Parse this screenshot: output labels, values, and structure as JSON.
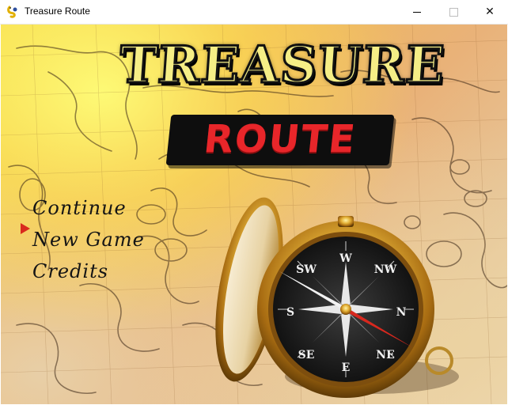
{
  "window": {
    "title": "Treasure Route",
    "app_icon": "pygame-snake-icon",
    "controls": [
      "minimize-icon",
      "maximize-icon",
      "close-icon"
    ]
  },
  "logo": {
    "line1": "TREASURE",
    "line2": "ROUTE",
    "colors": {
      "line1_fill": "#f5ee86",
      "line2_fill": "#e8262a",
      "line2_plate": "#0e0e0e"
    }
  },
  "menu": {
    "items": [
      {
        "label": "Continue"
      },
      {
        "label": "New Game"
      },
      {
        "label": "Credits"
      }
    ],
    "selected_index": 1,
    "cursor_color": "#d92a1e"
  },
  "compass": {
    "letters": [
      "W",
      "NW",
      "N",
      "NE",
      "E",
      "SE",
      "S",
      "SW"
    ]
  }
}
